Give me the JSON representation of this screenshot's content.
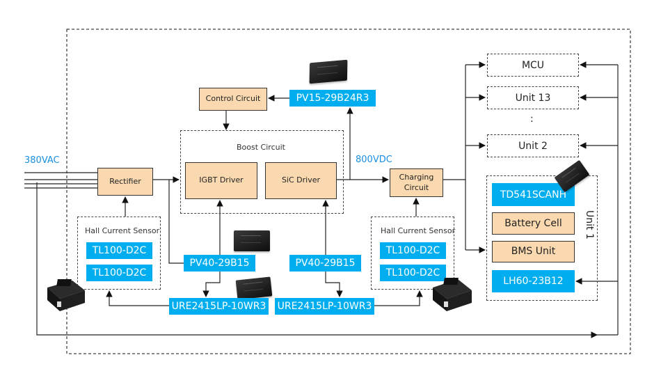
{
  "diagram": {
    "input_label": "380VAC",
    "dc_bus_label": "800VDC",
    "colors": {
      "module_blue": "#00aeef",
      "block_orange": "#fbd9b0",
      "voltage_label": "#1a8fe0"
    },
    "blocks": {
      "rectifier": "Rectifier",
      "control_circuit": "Control Circuit",
      "boost_container": "Boost Circuit",
      "igbt_driver": "IGBT Driver",
      "sic_driver": "SiC Driver",
      "charging_circuit": "Charging Circuit",
      "battery_cell": "Battery Cell",
      "bms_unit": "BMS Unit"
    },
    "modules": {
      "pv15": "PV15-29B24R3",
      "pv40_left": "PV40-29B15",
      "pv40_right": "PV40-29B15",
      "ure_left": "URE2415LP-10WR3",
      "ure_right": "URE2415LP-10WR3",
      "td541": "TD541SCANH",
      "lh60": "LH60-23B12"
    },
    "hall_sensor_left": {
      "title": "Hall Current Sensor",
      "items": [
        "TL100-D2C",
        "TL100-D2C"
      ]
    },
    "hall_sensor_right": {
      "title": "Hall Current Sensor",
      "items": [
        "TL100-D2C",
        "TL100-D2C"
      ]
    },
    "units": {
      "mcu": "MCU",
      "unit13": "Unit 13",
      "ellipsis": ":",
      "unit2": "Unit 2",
      "unit1_label": "Unit 1"
    },
    "device_images": [
      "pv15-module-photo",
      "pv40-module-photo",
      "ure-module-photo",
      "td541-module-photo",
      "hall-sensor-photo-left",
      "hall-sensor-photo-right"
    ]
  }
}
